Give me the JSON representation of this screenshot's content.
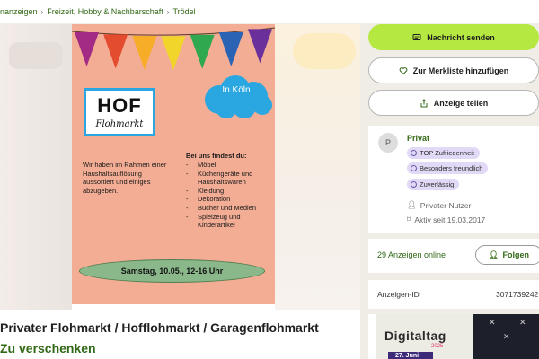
{
  "breadcrumb": {
    "items": [
      "nanzeigen",
      "Freizeit, Hobby & Nachbarschaft",
      "Trödel"
    ]
  },
  "flyer": {
    "title": "HOF",
    "subtitle": "Flohmarkt",
    "cloud": "In Köln",
    "left_text": "Wir haben im Rahmen einer Haushaltsauflösung aussortiert und einiges abzugeben.",
    "right_title": "Bei uns findest du:",
    "right_items": [
      "Möbel",
      "Küchengeräte und Haushaltswaren",
      "Kleidung",
      "Dekoration",
      "Bücher und Medien",
      "Spielzeug und Kinderartikel"
    ],
    "date": "Samstag, 10.05., 12-16 Uhr",
    "flag_colors": [
      "#a32b85",
      "#e44c2f",
      "#f7ad28",
      "#f1d52a",
      "#2fa84f",
      "#2a63b3",
      "#6a2f9a"
    ]
  },
  "ad": {
    "title": "Privater Flohmarkt / Hofflohmarkt / Garagenflohmarkt",
    "price": "Zu verschenken"
  },
  "actions": {
    "message": "Nachricht senden",
    "watchlist": "Zur Merkliste hinzufügen",
    "share": "Anzeige teilen"
  },
  "seller": {
    "avatar_letter": "P",
    "type": "Privat",
    "badges": [
      "TOP Zufriedenheit",
      "Besonders freundlich",
      "Zuverlässig"
    ],
    "user_kind": "Privater Nutzer",
    "active_since": "Aktiv seit 19.03.2017",
    "ads_online": "29 Anzeigen online",
    "follow": "Folgen"
  },
  "details": {
    "id_label": "Anzeigen-ID",
    "id_value": "3071739242"
  },
  "banner": {
    "word": "Digitaltag",
    "year": "2025",
    "date": "27. Juni"
  },
  "colors": {
    "accent_green": "#326916",
    "primary_button": "#b5e941",
    "badge_bg": "#e2d9f7",
    "flyer_bg": "#f3ad94"
  }
}
